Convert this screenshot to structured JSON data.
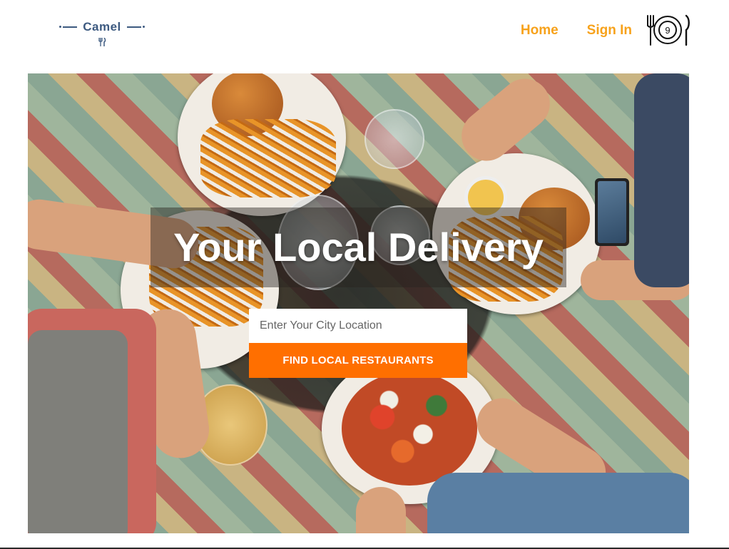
{
  "brand": {
    "name": "Camel"
  },
  "nav": {
    "home": "Home",
    "sign_in": "Sign In"
  },
  "cart": {
    "count": "9"
  },
  "hero": {
    "headline": "Your Local Delivery",
    "search_placeholder": "Enter Your City Location",
    "cta_label": "FIND LOCAL RESTAURANTS"
  },
  "colors": {
    "accent": "#f7a21b",
    "cta": "#ff6f00",
    "brand": "#3d5a80"
  },
  "icons": {
    "logo": "utensils-icon",
    "cart": "plate-cutlery-icon"
  }
}
